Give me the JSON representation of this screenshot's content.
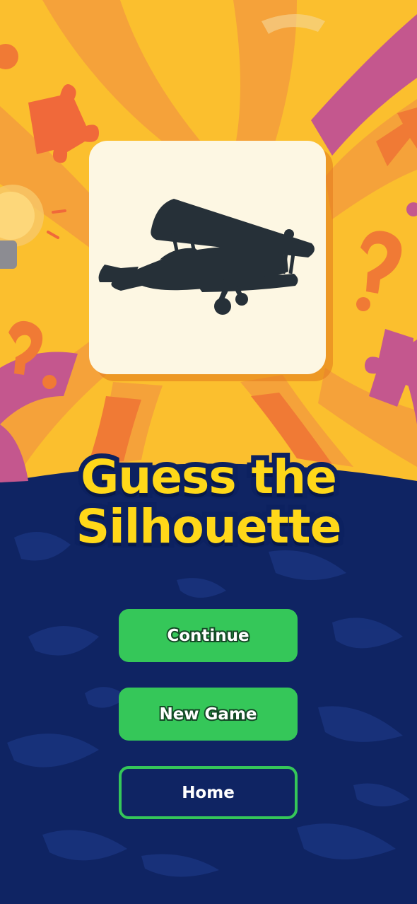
{
  "title": {
    "line1": "Guess the",
    "line2": "Silhouette"
  },
  "card": {
    "silhouette": "biplane-silhouette"
  },
  "menu": {
    "continue_label": "Continue",
    "new_game_label": "New Game",
    "home_label": "Home"
  },
  "colors": {
    "background_top": "#fbbf2e",
    "background_bottom": "#0f2463",
    "card": "#fdf7e3",
    "title_fill": "#ffd819",
    "title_outline": "#0c2160",
    "button_green": "#35c759"
  },
  "icons": [
    "puzzle-piece-icon",
    "question-mark-icon",
    "light-bulb-icon",
    "arrow-icon"
  ]
}
